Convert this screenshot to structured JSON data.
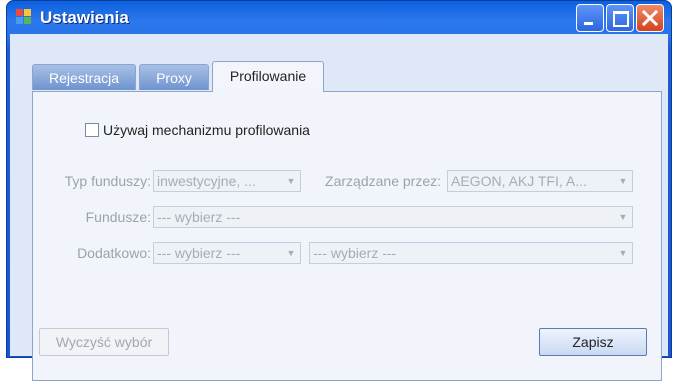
{
  "window": {
    "title": "Ustawienia",
    "icon": "app-window-icon",
    "controls": {
      "minimize": "minimize-icon",
      "maximize": "maximize-icon",
      "close": "close-icon"
    }
  },
  "tabs": [
    {
      "label": "Rejestracja",
      "active": false
    },
    {
      "label": "Proxy",
      "active": false
    },
    {
      "label": "Profilowanie",
      "active": true
    }
  ],
  "profiling": {
    "checkbox_label": "Używaj mechanizmu profilowania",
    "checked": false,
    "fund_type": {
      "label": "Typ funduszy:",
      "value": "inwestycyjne, ..."
    },
    "managed_by": {
      "label": "Zarządzane przez:",
      "value": "AEGON, AKJ TFI, A..."
    },
    "funds": {
      "label": "Fundusze:",
      "value": "--- wybierz ---"
    },
    "additional": {
      "label": "Dodatkowo:",
      "value1": "--- wybierz ---",
      "value2": "--- wybierz ---"
    },
    "clear_button": "Wyczyść wybór",
    "save_button": "Zapisz"
  },
  "colors": {
    "title_bar": "#1a56d0",
    "client_bg": "#dfe8f6",
    "panel_bg": "#f1f5fb",
    "close_button": "#d3421c"
  }
}
